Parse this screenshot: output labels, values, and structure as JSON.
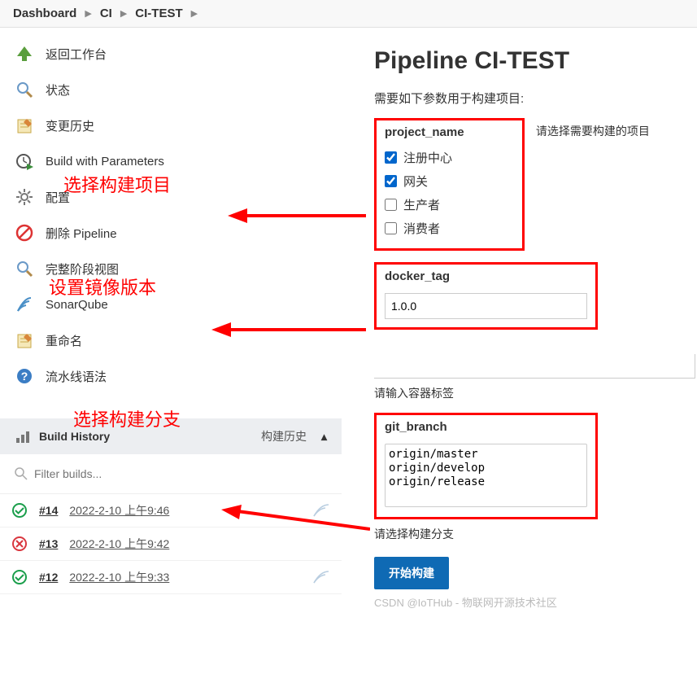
{
  "breadcrumb": {
    "dashboard": "Dashboard",
    "ci": "CI",
    "citest": "CI-TEST"
  },
  "sidebar": {
    "items": [
      {
        "label": "返回工作台"
      },
      {
        "label": "状态"
      },
      {
        "label": "变更历史"
      },
      {
        "label": "Build with Parameters"
      },
      {
        "label": "配置"
      },
      {
        "label": "删除 Pipeline"
      },
      {
        "label": "完整阶段视图"
      },
      {
        "label": "SonarQube"
      },
      {
        "label": "重命名"
      },
      {
        "label": "流水线语法"
      }
    ]
  },
  "annotations": {
    "select_project": "选择构建项目",
    "set_image_version": "设置镜像版本",
    "select_branch": "选择构建分支"
  },
  "build_history": {
    "title": "Build History",
    "trend_label": "构建历史",
    "filter_placeholder": "Filter builds...",
    "rows": [
      {
        "num": "#14",
        "date": "2022-2-10 上午9:46",
        "status": "success"
      },
      {
        "num": "#13",
        "date": "2022-2-10 上午9:42",
        "status": "fail"
      },
      {
        "num": "#12",
        "date": "2022-2-10 上午9:33",
        "status": "success"
      }
    ]
  },
  "main": {
    "title": "Pipeline CI-TEST",
    "params_desc": "需要如下参数用于构建项目:",
    "project_name": {
      "label": "project_name",
      "side_note": "请选择需要构建的项目",
      "options": [
        {
          "label": "注册中心",
          "checked": true
        },
        {
          "label": "网关",
          "checked": true
        },
        {
          "label": "生产者",
          "checked": false
        },
        {
          "label": "消费者",
          "checked": false
        }
      ]
    },
    "docker_tag": {
      "label": "docker_tag",
      "value": "1.0.0",
      "help": "请输入容器标签"
    },
    "git_branch": {
      "label": "git_branch",
      "options": [
        "origin/master",
        "origin/develop",
        "origin/release"
      ],
      "help": "请选择构建分支"
    },
    "submit": "开始构建",
    "watermark": "CSDN @IoTHub - 物联网开源技术社区"
  }
}
